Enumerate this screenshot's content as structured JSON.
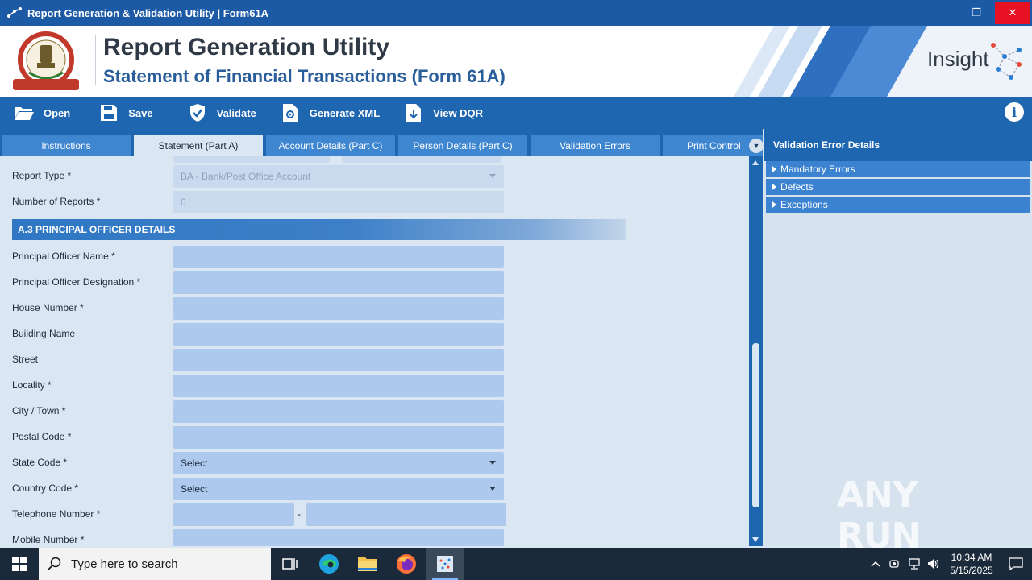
{
  "window": {
    "title": "Report Generation & Validation Utility | Form61A",
    "controls": {
      "minimize": "—",
      "restore": "❐",
      "close": "✕"
    }
  },
  "header": {
    "title": "Report Generation Utility",
    "subtitle": "Statement of Financial Transactions (Form 61A)",
    "brand": "Insight",
    "emblem_text": "INCOME TAX DEPARTMENT"
  },
  "toolbar": {
    "open": "Open",
    "save": "Save",
    "validate": "Validate",
    "generate_xml": "Generate XML",
    "view_dqr": "View DQR",
    "info": "i"
  },
  "tabs": [
    {
      "label": "Instructions",
      "active": false
    },
    {
      "label": "Statement (Part A)",
      "active": true
    },
    {
      "label": "Account Details (Part C)",
      "active": false
    },
    {
      "label": "Person Details (Part C)",
      "active": false
    },
    {
      "label": "Validation Errors",
      "active": false
    },
    {
      "label": "Print Control",
      "active": false
    }
  ],
  "form": {
    "report_type": {
      "label": "Report Type *",
      "value": "BA - Bank/Post Office Account"
    },
    "number_of_reports": {
      "label": "Number of Reports *",
      "value": "0"
    },
    "section_title": "A.3 PRINCIPAL OFFICER DETAILS",
    "fields": [
      {
        "label": "Principal Officer Name *",
        "value": ""
      },
      {
        "label": "Principal Officer Designation *",
        "value": ""
      },
      {
        "label": "House Number *",
        "value": ""
      },
      {
        "label": "Building Name",
        "value": ""
      },
      {
        "label": "Street",
        "value": ""
      },
      {
        "label": "Locality *",
        "value": ""
      },
      {
        "label": "City / Town *",
        "value": ""
      },
      {
        "label": "Postal Code *",
        "value": ""
      }
    ],
    "state_code": {
      "label": "State Code *",
      "value": "Select"
    },
    "country_code": {
      "label": "Country Code *",
      "value": "Select"
    },
    "telephone": {
      "label": "Telephone Number *",
      "separator": "-"
    },
    "mobile": {
      "label": "Mobile Number *"
    }
  },
  "right_panel": {
    "title": "Validation Error Details",
    "items": [
      "Mandatory Errors",
      "Defects",
      "Exceptions"
    ]
  },
  "watermark": "ANY RUN",
  "taskbar": {
    "search_placeholder": "Type here to search",
    "time": "10:34 AM",
    "date": "5/15/2025"
  },
  "colors": {
    "titlebar": "#1d5aa6",
    "toolbar": "#1f66b1",
    "field": "#aec9ee",
    "close": "#e81123"
  }
}
